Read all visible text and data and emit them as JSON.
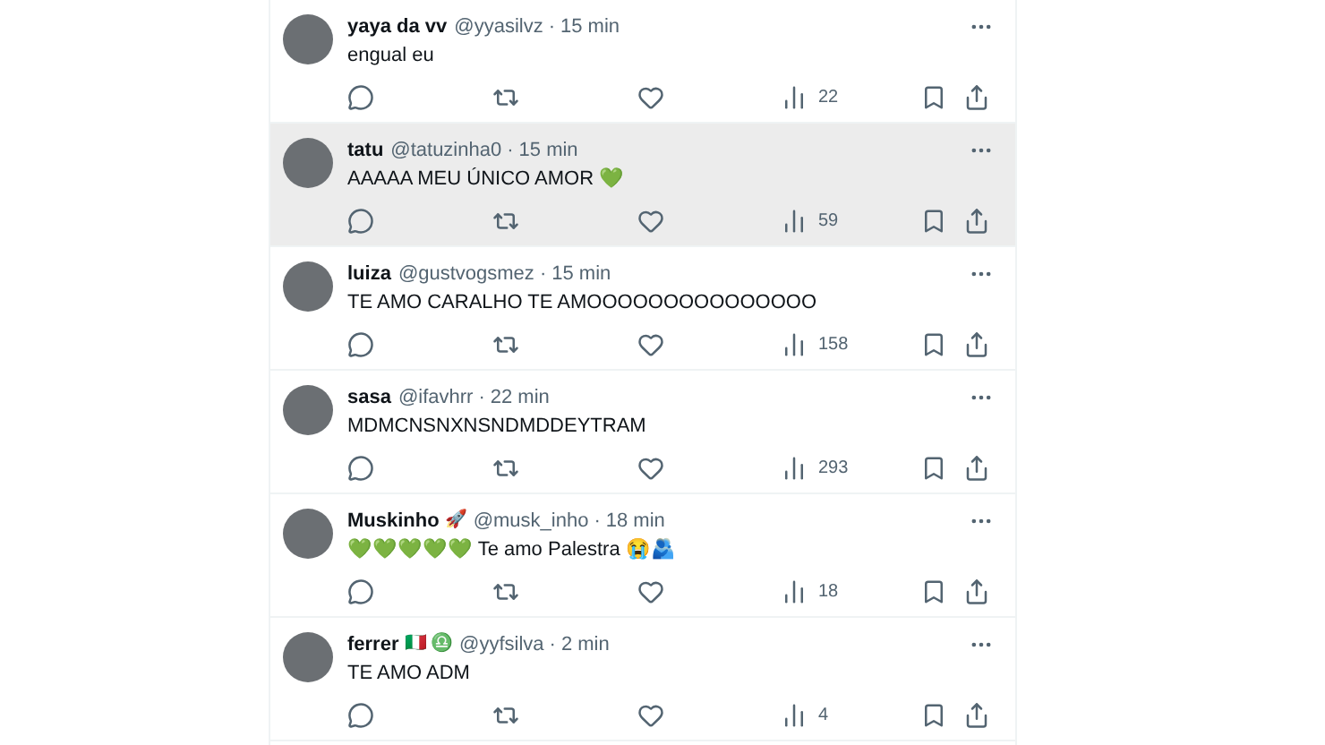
{
  "posts": [
    {
      "name": "yaya da vv",
      "handle": "@yyasilvz",
      "dot": "·",
      "time": "15 min",
      "text": "engual eu",
      "views": "22",
      "highlighted": false
    },
    {
      "name": "tatu",
      "handle": "@tatuzinha0",
      "dot": "·",
      "time": "15 min",
      "text": "AAAAA MEU ÚNICO AMOR 💚",
      "views": "59",
      "highlighted": true
    },
    {
      "name": "luiza",
      "handle": "@gustvogsmez",
      "dot": "·",
      "time": "15 min",
      "text": "TE AMO CARALHO TE AMOOOOOOOOOOOOOOO",
      "views": "158",
      "highlighted": false
    },
    {
      "name": "sasa",
      "handle": "@ifavhrr",
      "dot": "·",
      "time": "22 min",
      "text": "MDMCNSNXNSNDMDDEYTRAM",
      "views": "293",
      "highlighted": false
    },
    {
      "name": "Muskinho",
      "badges": "🚀",
      "handle": "@musk_inho",
      "dot": "·",
      "time": "18 min",
      "text": "💚💚💚💚💚 Te amo Palestra 😭🫂",
      "views": "18",
      "highlighted": false
    },
    {
      "name": "ferrer",
      "badges": "🇮🇹 ♎",
      "handle": "@yyfsilva",
      "dot": "·",
      "time": "2 min",
      "text": "TE AMO ADM",
      "views": "4",
      "highlighted": false
    }
  ]
}
